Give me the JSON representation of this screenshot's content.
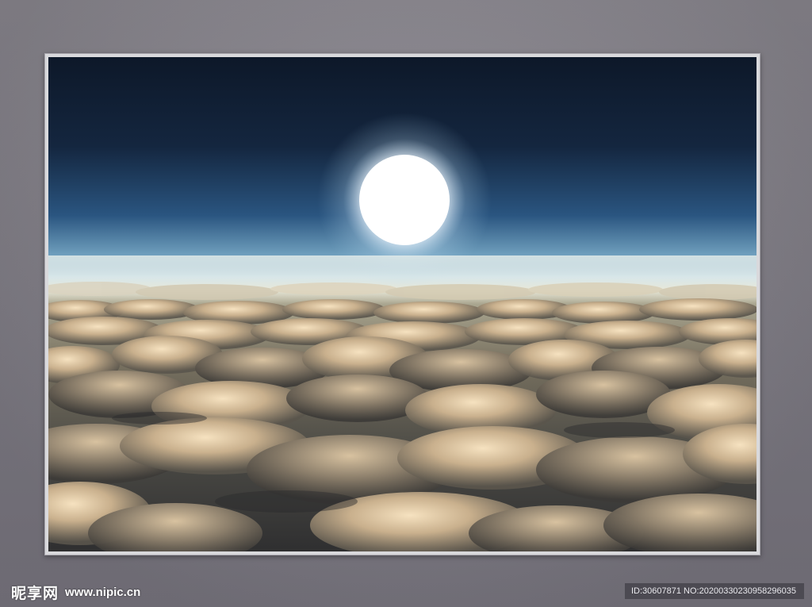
{
  "watermark": {
    "brand": "昵享网",
    "url": "www.nipic.cn"
  },
  "id_bar": {
    "text": "ID:30607871 NO:20200330230958296035"
  },
  "scene": {
    "subject": "sun above a sea of clouds",
    "colors": {
      "sky_top": "#0e1a2e",
      "sky_mid": "#2e5a86",
      "horizon": "#cfe3ea",
      "cloud_light": "#f3dcb8",
      "cloud_shadow": "#3b3b3c"
    }
  }
}
